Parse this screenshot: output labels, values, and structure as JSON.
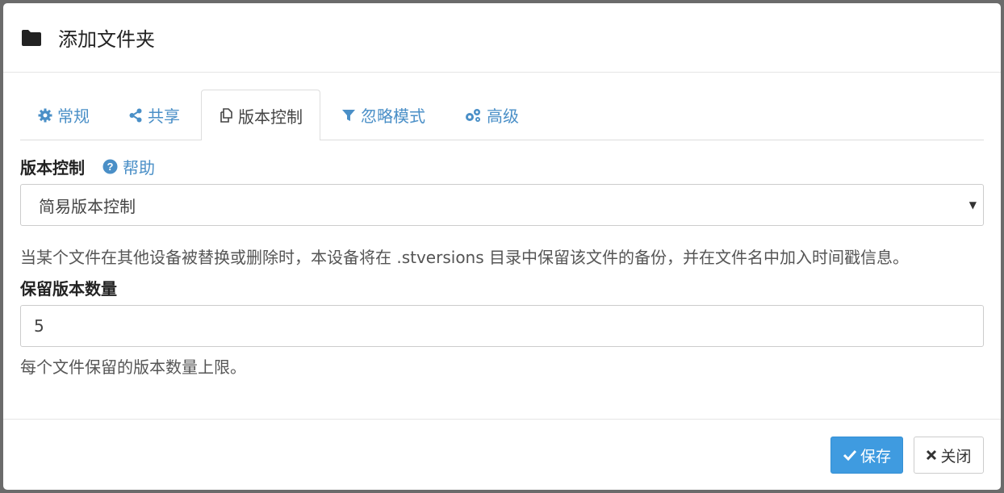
{
  "modal": {
    "title": "添加文件夹",
    "icon": "folder-icon"
  },
  "tabs": [
    {
      "label": "常规",
      "icon": "gear-icon",
      "active": false
    },
    {
      "label": "共享",
      "icon": "share-icon",
      "active": false
    },
    {
      "label": "版本控制",
      "icon": "copy-icon",
      "active": true
    },
    {
      "label": "忽略模式",
      "icon": "filter-icon",
      "active": false
    },
    {
      "label": "高级",
      "icon": "gears-icon",
      "active": false
    }
  ],
  "versioning": {
    "label": "版本控制",
    "help_label": "帮助",
    "selected": "简易版本控制",
    "description": "当某个文件在其他设备被替换或删除时，本设备将在 .stversions 目录中保留该文件的备份，并在文件名中加入时间戳信息。"
  },
  "keep_versions": {
    "label": "保留版本数量",
    "value": "5",
    "description": "每个文件保留的版本数量上限。"
  },
  "footer": {
    "save_label": "保存",
    "close_label": "关闭"
  },
  "colors": {
    "accent": "#4a8fc7",
    "primary_button": "#3f9be0"
  }
}
